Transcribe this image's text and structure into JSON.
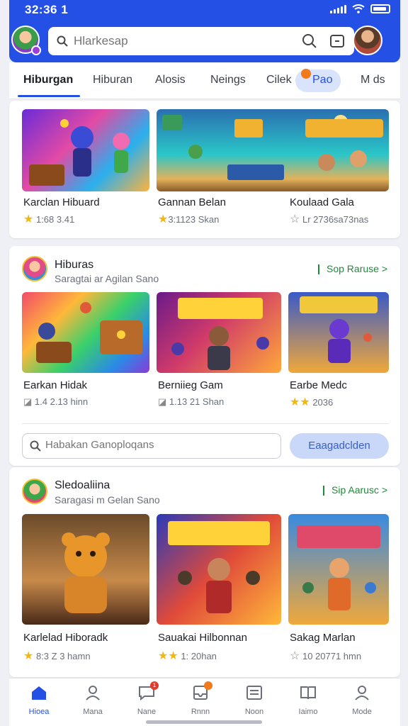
{
  "status_bar": {
    "time": "32:36 1"
  },
  "search": {
    "placeholder": "Hlarkesap"
  },
  "tabs": [
    {
      "label": "Hiburgan",
      "active": true
    },
    {
      "label": "Hiburan"
    },
    {
      "label": "Alosis"
    },
    {
      "label": "Neings"
    },
    {
      "label": "Cilek"
    },
    {
      "label": "Pao"
    },
    {
      "label": "M ds"
    }
  ],
  "section1": {
    "games": [
      {
        "title": "Karclan Hibuard",
        "meta": "1:68 3.41",
        "rating_icon": "star"
      },
      {
        "title": "Gannan Belan",
        "meta": "3:1123 Skan",
        "rating_icon": "star"
      },
      {
        "title": "Koulaad Gala",
        "meta": "Lr 2736sa73nas",
        "rating_icon": "star-outline"
      }
    ]
  },
  "section2": {
    "title": "Hiburas",
    "subtitle": "Saragtai ar Agilan Sano",
    "see_all": "Sop Raruse >",
    "games": [
      {
        "title": "Earkan Hidak",
        "meta": "1.4 2.13 hinn",
        "rating_icon": "tag"
      },
      {
        "title": "Berniieg Gam",
        "meta": "1.13 21 Shan",
        "rating_icon": "tag"
      },
      {
        "title": "Earbe Medc",
        "meta": "2036",
        "rating_icon": "stars"
      }
    ],
    "search_placeholder": "Habakan Ganoploqans",
    "button_label": "Eaagadclden"
  },
  "section3": {
    "title": "Sledoaliina",
    "subtitle": "Saragasi m Gelan Sano",
    "see_all": "Sip Aarusc >",
    "games": [
      {
        "title": "Karlelad Hiboradk",
        "meta": "8:3 Z 3 hamn",
        "rating_icon": "star"
      },
      {
        "title": "Sauakai Hilbonnan",
        "meta": "1: 20han",
        "rating_icon": "stars"
      },
      {
        "title": "Sakag Marlan",
        "meta": "10 20771 hmn",
        "rating_icon": "star-outline"
      }
    ]
  },
  "bottom_nav": [
    {
      "label": "Hioea",
      "icon": "home-icon",
      "active": true
    },
    {
      "label": "Mana",
      "icon": "profile-icon"
    },
    {
      "label": "Nane",
      "icon": "chat-icon",
      "badge": "1"
    },
    {
      "label": "Rnnn",
      "icon": "inbox-icon",
      "badge": ""
    },
    {
      "label": "Noon",
      "icon": "list-icon"
    },
    {
      "label": "Iaimo",
      "icon": "book-icon"
    },
    {
      "label": "Mode",
      "icon": "user-settings-icon"
    }
  ],
  "colors": {
    "primary": "#2450e6",
    "accent_green": "#1f8a3a",
    "star": "#f2b713"
  }
}
